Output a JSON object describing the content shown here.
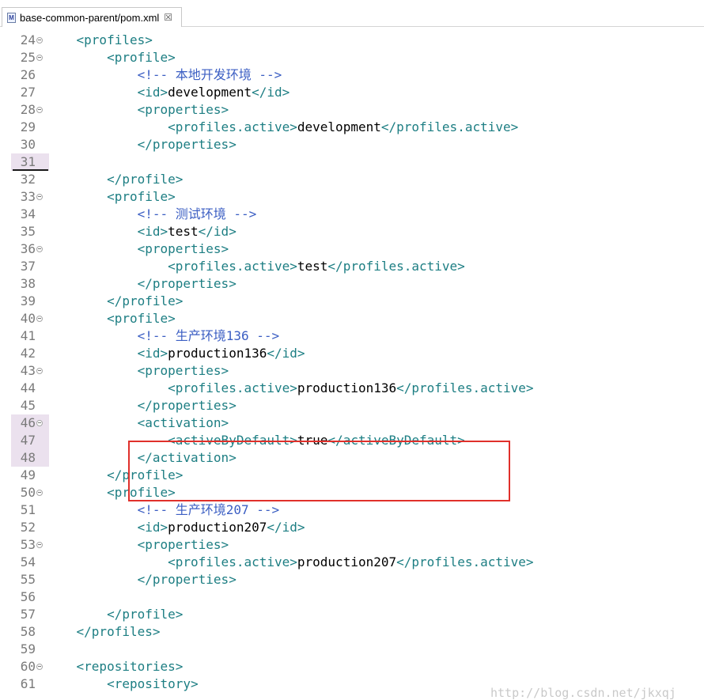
{
  "tab": {
    "icon": "M",
    "title": "base-common-parent/pom.xml",
    "close": "☒"
  },
  "gutter": [
    {
      "n": "24",
      "fold": true
    },
    {
      "n": "25",
      "fold": true
    },
    {
      "n": "26",
      "fold": false
    },
    {
      "n": "27",
      "fold": false
    },
    {
      "n": "28",
      "fold": true
    },
    {
      "n": "29",
      "fold": false
    },
    {
      "n": "30",
      "fold": false
    },
    {
      "n": "31",
      "fold": false,
      "highlight": true,
      "cursor": true
    },
    {
      "n": "32",
      "fold": false
    },
    {
      "n": "33",
      "fold": true
    },
    {
      "n": "34",
      "fold": false
    },
    {
      "n": "35",
      "fold": false
    },
    {
      "n": "36",
      "fold": true
    },
    {
      "n": "37",
      "fold": false
    },
    {
      "n": "38",
      "fold": false
    },
    {
      "n": "39",
      "fold": false
    },
    {
      "n": "40",
      "fold": true
    },
    {
      "n": "41",
      "fold": false
    },
    {
      "n": "42",
      "fold": false
    },
    {
      "n": "43",
      "fold": true
    },
    {
      "n": "44",
      "fold": false
    },
    {
      "n": "45",
      "fold": false
    },
    {
      "n": "46",
      "fold": true,
      "highlight": true
    },
    {
      "n": "47",
      "fold": false,
      "highlight": true
    },
    {
      "n": "48",
      "fold": false,
      "highlight": true
    },
    {
      "n": "49",
      "fold": false
    },
    {
      "n": "50",
      "fold": true
    },
    {
      "n": "51",
      "fold": false
    },
    {
      "n": "52",
      "fold": false
    },
    {
      "n": "53",
      "fold": true
    },
    {
      "n": "54",
      "fold": false
    },
    {
      "n": "55",
      "fold": false
    },
    {
      "n": "56",
      "fold": false
    },
    {
      "n": "57",
      "fold": false
    },
    {
      "n": "58",
      "fold": false
    },
    {
      "n": "59",
      "fold": false
    },
    {
      "n": "60",
      "fold": true
    },
    {
      "n": "61",
      "fold": false
    }
  ],
  "code": [
    [
      {
        "t": "tag",
        "v": "    <profiles>"
      }
    ],
    [
      {
        "t": "tag",
        "v": "        <profile>"
      }
    ],
    [
      {
        "t": "cmt",
        "v": "            <!-- 本地开发环境 -->"
      }
    ],
    [
      {
        "t": "tag",
        "v": "            <id>"
      },
      {
        "t": "txt",
        "v": "development"
      },
      {
        "t": "tag",
        "v": "</id>"
      }
    ],
    [
      {
        "t": "tag",
        "v": "            <properties>"
      }
    ],
    [
      {
        "t": "tag",
        "v": "                <profiles.active>"
      },
      {
        "t": "txt",
        "v": "development"
      },
      {
        "t": "tag",
        "v": "</profiles.active>"
      }
    ],
    [
      {
        "t": "tag",
        "v": "            </properties>"
      }
    ],
    [],
    [
      {
        "t": "tag",
        "v": "        </profile>"
      }
    ],
    [
      {
        "t": "tag",
        "v": "        <profile>"
      }
    ],
    [
      {
        "t": "cmt",
        "v": "            <!-- 测试环境 -->"
      }
    ],
    [
      {
        "t": "tag",
        "v": "            <id>"
      },
      {
        "t": "txt",
        "v": "test"
      },
      {
        "t": "tag",
        "v": "</id>"
      }
    ],
    [
      {
        "t": "tag",
        "v": "            <properties>"
      }
    ],
    [
      {
        "t": "tag",
        "v": "                <profiles.active>"
      },
      {
        "t": "txt",
        "v": "test"
      },
      {
        "t": "tag",
        "v": "</profiles.active>"
      }
    ],
    [
      {
        "t": "tag",
        "v": "            </properties>"
      }
    ],
    [
      {
        "t": "tag",
        "v": "        </profile>"
      }
    ],
    [
      {
        "t": "tag",
        "v": "        <profile>"
      }
    ],
    [
      {
        "t": "cmt",
        "v": "            <!-- 生产环境136 -->"
      }
    ],
    [
      {
        "t": "tag",
        "v": "            <id>"
      },
      {
        "t": "txt",
        "v": "production136"
      },
      {
        "t": "tag",
        "v": "</id>"
      }
    ],
    [
      {
        "t": "tag",
        "v": "            <properties>"
      }
    ],
    [
      {
        "t": "tag",
        "v": "                <profiles.active>"
      },
      {
        "t": "txt",
        "v": "production136"
      },
      {
        "t": "tag",
        "v": "</profiles.active>"
      }
    ],
    [
      {
        "t": "tag",
        "v": "            </properties>"
      }
    ],
    [
      {
        "t": "tag",
        "v": "            <activation>"
      }
    ],
    [
      {
        "t": "tag",
        "v": "                <activeByDefault>"
      },
      {
        "t": "txt",
        "v": "true"
      },
      {
        "t": "tag",
        "v": "</activeByDefault>"
      }
    ],
    [
      {
        "t": "tag",
        "v": "            </activation>"
      }
    ],
    [
      {
        "t": "tag",
        "v": "        </profile>"
      }
    ],
    [
      {
        "t": "tag",
        "v": "        <profile>"
      }
    ],
    [
      {
        "t": "cmt",
        "v": "            <!-- 生产环境207 -->"
      }
    ],
    [
      {
        "t": "tag",
        "v": "            <id>"
      },
      {
        "t": "txt",
        "v": "production207"
      },
      {
        "t": "tag",
        "v": "</id>"
      }
    ],
    [
      {
        "t": "tag",
        "v": "            <properties>"
      }
    ],
    [
      {
        "t": "tag",
        "v": "                <profiles.active>"
      },
      {
        "t": "txt",
        "v": "production207"
      },
      {
        "t": "tag",
        "v": "</profiles.active>"
      }
    ],
    [
      {
        "t": "tag",
        "v": "            </properties>"
      }
    ],
    [],
    [
      {
        "t": "tag",
        "v": "        </profile>"
      }
    ],
    [
      {
        "t": "tag",
        "v": "    </profiles>"
      }
    ],
    [],
    [
      {
        "t": "tag",
        "v": "    <repositories>"
      }
    ],
    [
      {
        "t": "tag",
        "v": "        <repository>"
      }
    ]
  ],
  "watermark": "http://blog.csdn.net/jkxqj"
}
